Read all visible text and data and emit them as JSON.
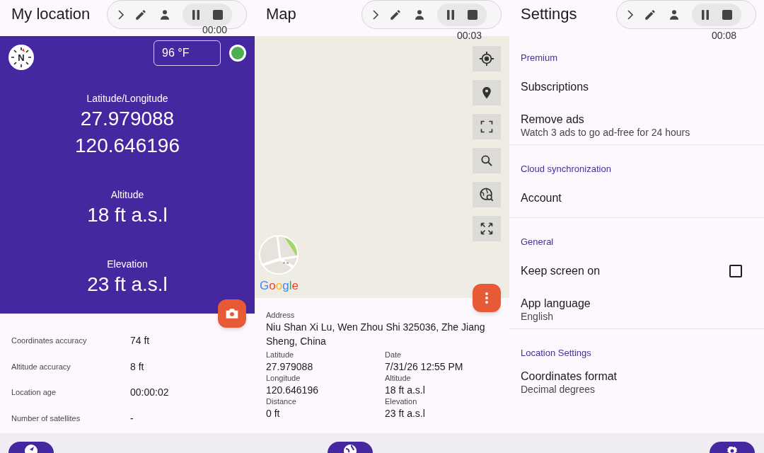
{
  "location": {
    "title": "My location",
    "timer": "00:00",
    "temperature": "96 °F",
    "compass_label": "N",
    "gps_fixed": true,
    "readings": [
      {
        "label": "Latitude/Longitude",
        "values": [
          "27.979088",
          "120.646196"
        ]
      },
      {
        "label": "Altitude",
        "values": [
          "18 ft a.s.l"
        ]
      },
      {
        "label": "Elevation",
        "values": [
          "23 ft a.s.l"
        ]
      }
    ],
    "details": [
      {
        "label": "Coordinates accuracy",
        "value": "74 ft"
      },
      {
        "label": "Altitude accuracy",
        "value": "8 ft"
      },
      {
        "label": "Location age",
        "value": "00:00:02"
      },
      {
        "label": "Number of satellites",
        "value": "-"
      }
    ]
  },
  "map": {
    "title": "Map",
    "timer": "00:03",
    "attribution": "Google",
    "address_label": "Address",
    "address": "Niu Shan Xi Lu, Wen Zhou Shi 325036, Zhe Jiang Sheng, China",
    "fields": [
      {
        "label": "Latitude",
        "value": "27.979088"
      },
      {
        "label": "Date",
        "value": "7/31/26 12:55 PM"
      },
      {
        "label": "Longitude",
        "value": "120.646196"
      },
      {
        "label": "Altitude",
        "value": "18 ft a.s.l"
      },
      {
        "label": "Distance",
        "value": "0 ft"
      },
      {
        "label": "Elevation",
        "value": "23 ft a.s.l"
      }
    ]
  },
  "settings": {
    "title": "Settings",
    "timer": "00:08",
    "sections": [
      {
        "header": "Premium",
        "items": [
          {
            "kind": "link",
            "title": "Subscriptions"
          },
          {
            "kind": "link",
            "title": "Remove ads",
            "subtitle": "Watch 3 ads to go ad-free for 24 hours"
          }
        ]
      },
      {
        "header": "Cloud synchronization",
        "items": [
          {
            "kind": "link",
            "title": "Account"
          }
        ]
      },
      {
        "header": "General",
        "items": [
          {
            "kind": "checkbox",
            "title": "Keep screen on",
            "checked": false
          },
          {
            "kind": "link",
            "title": "App language",
            "subtitle": "English"
          }
        ]
      },
      {
        "header": "Location Settings",
        "items": [
          {
            "kind": "link",
            "title": "Coordinates format",
            "subtitle": "Decimal degrees"
          }
        ]
      }
    ]
  }
}
